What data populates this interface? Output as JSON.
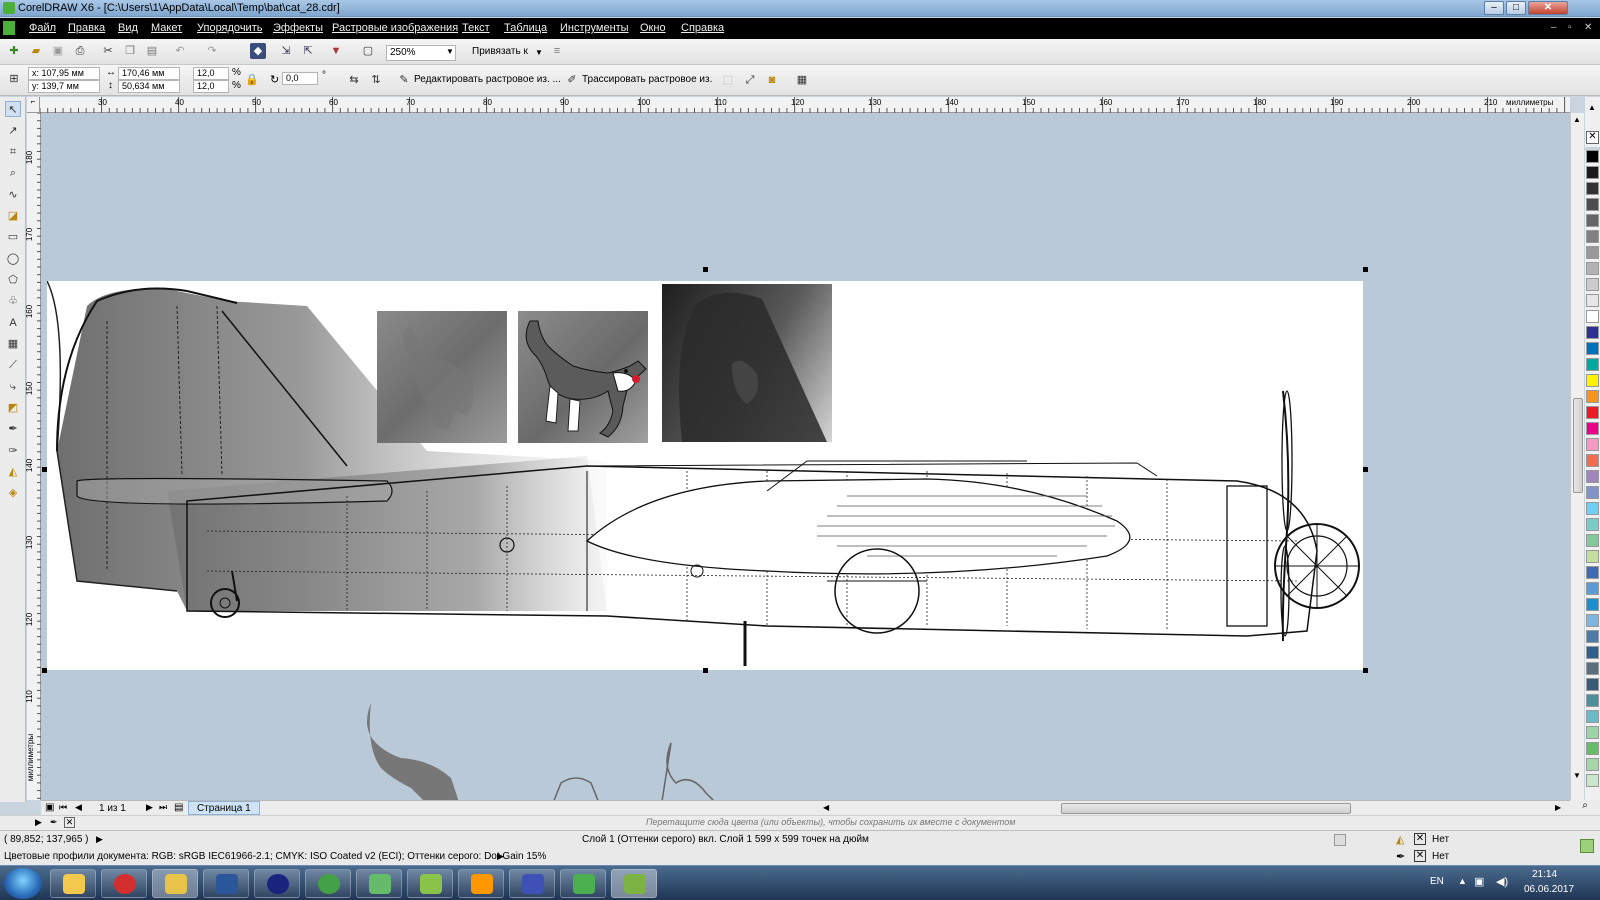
{
  "titlebar": {
    "title": "CorelDRAW X6 - [C:\\Users\\1\\AppData\\Local\\Temp\\bat\\cat_28.cdr]",
    "minimize_icon": "minimize-icon",
    "maximize_icon": "maximize-icon",
    "close_icon": "close-icon"
  },
  "menu": [
    "Файл",
    "Правка",
    "Вид",
    "Макет",
    "Упорядочить",
    "Эффекты",
    "Растровые изображения",
    "Текст",
    "Таблица",
    "Инструменты",
    "Окно",
    "Справка"
  ],
  "toolbar": {
    "zoom": "250%",
    "snap_to": "Привязать к"
  },
  "properties": {
    "x": "x: 107,95 мм",
    "y": "y: 139,7 мм",
    "width": "170,46 мм",
    "height": "50,634 мм",
    "scale_x": "12,0",
    "scale_y": "12,0",
    "percent": "%",
    "angle": "0,0",
    "degree": "°",
    "edit_bitmap": "Редактировать растровое из. ...",
    "trace_bitmap": "Трассировать растровое из."
  },
  "ruler": {
    "h_ticks": [
      "30",
      "40",
      "50",
      "60",
      "70",
      "80",
      "90",
      "100",
      "110",
      "120",
      "130",
      "140",
      "150",
      "160",
      "170",
      "180",
      "190",
      "200",
      "210"
    ],
    "h_unit": "миллиметры",
    "v_ticks": [
      "180",
      "170",
      "160",
      "150",
      "140",
      "130",
      "120",
      "110"
    ],
    "v_unit": "миллиметры"
  },
  "page_nav": {
    "counter": "1 из 1",
    "tab": "Страница 1"
  },
  "docbar_hint": "Перетащите сюда цвета (или объекты), чтобы сохранить их вместе с документом",
  "status": {
    "coords": "( 89,852; 137,965 )",
    "layer": "Слой 1 (Оттенки серого) вкл. Слой 1 599 x 599 точек на дюйм",
    "profiles": "Цветовые профили документа: RGB: sRGB IEC61966-2.1; CMYK: ISO Coated v2 (ECI); Оттенки серого: Dot Gain 15%",
    "fill": "Нет",
    "outline": "Нет"
  },
  "taskbar": {
    "lang": "EN",
    "time": "21:14",
    "date": "06.06.2017"
  },
  "palette_colors": [
    "#000000",
    "#1a1a1a",
    "#333333",
    "#4d4d4d",
    "#666666",
    "#808080",
    "#999999",
    "#b3b3b3",
    "#cccccc",
    "#e6e6e6",
    "#ffffff",
    "#2e3192",
    "#0071bc",
    "#00a99d",
    "#fff200",
    "#f7941d",
    "#ed1c24",
    "#ec008c",
    "#f49ac1",
    "#f26c4f",
    "#a186be",
    "#8393ca",
    "#6dcff6",
    "#7accc8",
    "#82ca9c",
    "#c4df9b",
    "#3d6ab3",
    "#5b9bd5",
    "#1c8fd0",
    "#7fb3e0",
    "#4b7ba6",
    "#2f5f8c",
    "#5c6e7e",
    "#3a5a7a",
    "#4e8f9c",
    "#6cbac9",
    "#9cd4a8",
    "#66bb6a",
    "#a5d6a7",
    "#c8e6c9"
  ]
}
